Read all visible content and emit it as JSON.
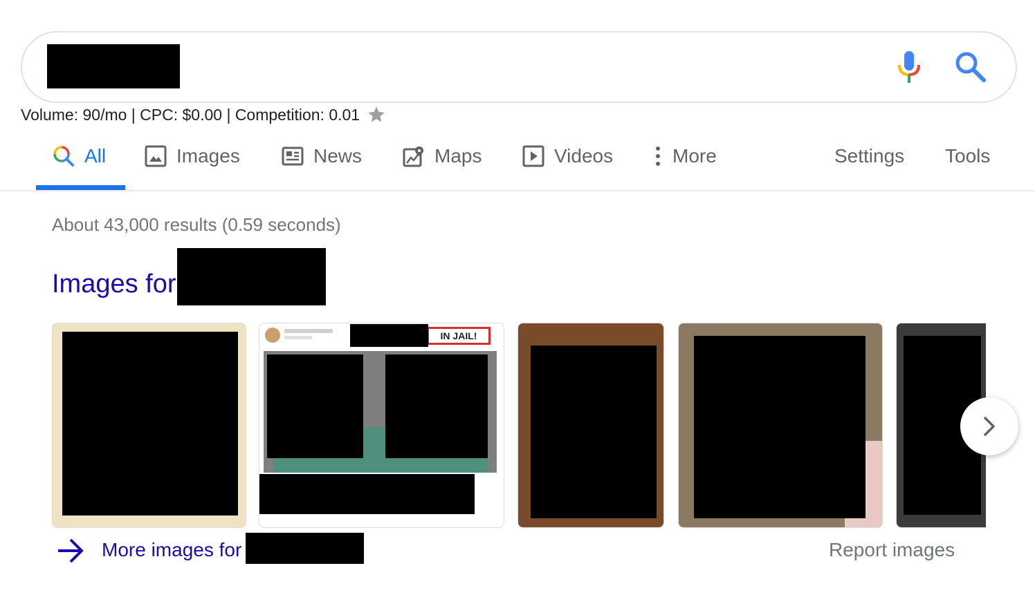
{
  "search": {
    "query": "",
    "query_redacted": true,
    "mic_icon": "mic-icon",
    "search_icon": "search-icon"
  },
  "keyword_stats": {
    "text": "Volume: 90/mo | CPC: $0.00 | Competition: 0.01",
    "star_icon": "star-icon"
  },
  "tabs": [
    {
      "label": "All",
      "icon": "search-icon",
      "active": true
    },
    {
      "label": "Images",
      "icon": "image-icon",
      "active": false
    },
    {
      "label": "News",
      "icon": "newspaper-icon",
      "active": false
    },
    {
      "label": "Maps",
      "icon": "map-pin-icon",
      "active": false
    },
    {
      "label": "Videos",
      "icon": "play-icon",
      "active": false
    },
    {
      "label": "More",
      "icon": "vertical-dots-icon",
      "active": false
    }
  ],
  "settings_label": "Settings",
  "tools_label": "Tools",
  "result_stats": "About 43,000 results (0.59 seconds)",
  "images_section": {
    "heading": "Images for",
    "thumb_2_banner": "IN JAIL!",
    "more_images_label": "More images for",
    "report_images_label": "Report images"
  },
  "colors": {
    "accent_blue": "#1a73e8",
    "link_blue": "#1a0dab",
    "muted_gray": "#70757a"
  }
}
